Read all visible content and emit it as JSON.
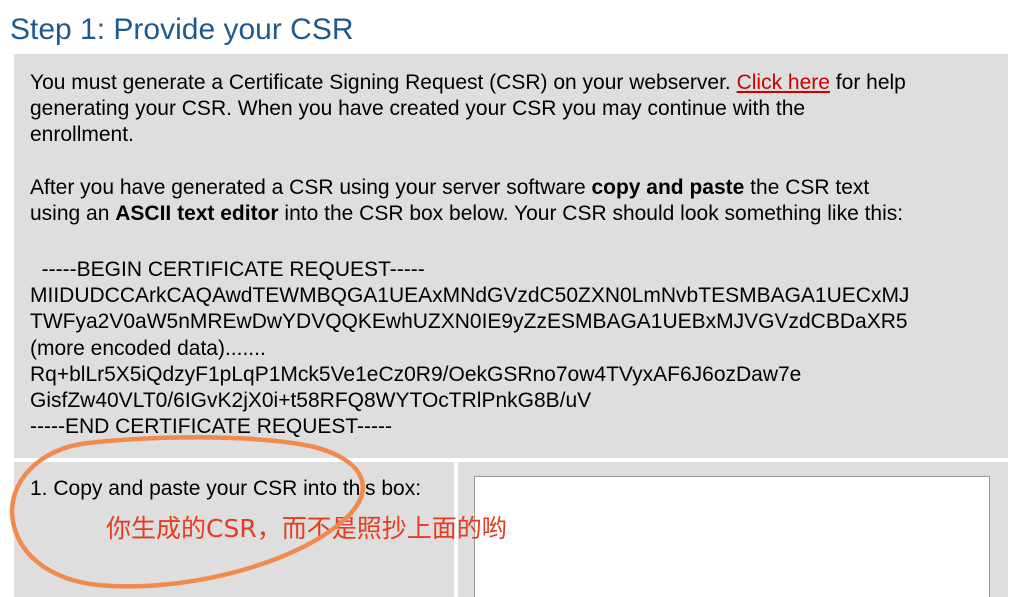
{
  "step": {
    "title": "Step 1: Provide your CSR"
  },
  "intro": {
    "para1_before": "You must generate a Certificate Signing Request (CSR) on your webserver. ",
    "help_link": "Click here",
    "para1_line1_after": " for help",
    "para1_line2": "generating your CSR. When you have created your CSR you may continue with the",
    "para1_line3": "enrollment.",
    "para2_l1_a": "After you have generated a CSR using your server software ",
    "para2_l1_bold": "copy and paste",
    "para2_l1_b": " the CSR text",
    "para2_l2_a": "using an ",
    "para2_l2_bold": "ASCII text editor",
    "para2_l2_b": " into the CSR box below. Your CSR should look something like this:"
  },
  "csr_sample": {
    "lines": [
      "  -----BEGIN CERTIFICATE REQUEST-----",
      "MIIDUDCCArkCAQAwdTEWMBQGA1UEAxMNdGVzdC50ZXN0LmNvbTESMBAGA1UECxMJ",
      "TWFya2V0aW5nMREwDwYDVQQKEwhUZXN0IE9yZzESMBAGA1UEBxMJVGVzdCBDaXR5",
      "(more encoded data).......",
      "Rq+blLr5X5iQdzyF1pLqP1Mck5Ve1eCz0R9/OekGSRno7ow4TVyxAF6J6ozDaw7e",
      "GisfZw40VLT0/6IGvK2jX0i+t58RFQ8WYTOcTRlPnkG8B/uV",
      "-----END CERTIFICATE REQUEST-----"
    ]
  },
  "form": {
    "csr_label": "1. Copy and paste your CSR into this box:",
    "csr_value": ""
  },
  "annotation": {
    "text": "你生成的CSR，而不是照抄上面的哟",
    "color": "#e63b1e",
    "circle_color": "#f28a4e"
  },
  "colors": {
    "title": "#1f5a8f",
    "panel": "#dedede",
    "link": "#cc0000"
  }
}
